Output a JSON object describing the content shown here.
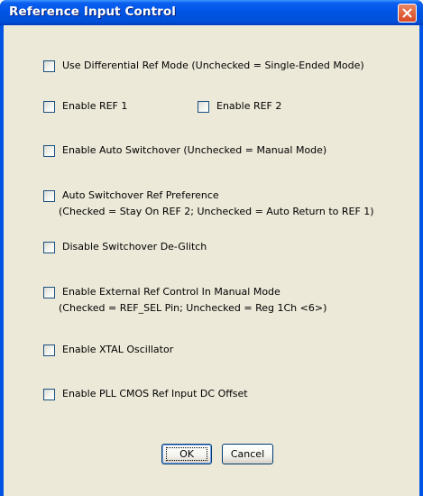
{
  "window": {
    "title": "Reference Input Control",
    "close_icon": "close-icon"
  },
  "options": {
    "diff_ref_mode": {
      "label": "Use Differential Ref Mode (Unchecked = Single-Ended Mode)",
      "checked": false
    },
    "enable_ref1": {
      "label": "Enable REF 1",
      "checked": false
    },
    "enable_ref2": {
      "label": "Enable REF 2",
      "checked": false
    },
    "auto_switchover": {
      "label": "Enable Auto Switchover (Unchecked = Manual Mode)",
      "checked": false
    },
    "switchover_pref": {
      "label": "Auto Switchover Ref Preference",
      "note": "(Checked = Stay On REF 2; Unchecked = Auto Return to REF 1)",
      "checked": false
    },
    "deglitch": {
      "label": "Disable Switchover De-Glitch",
      "checked": false
    },
    "ext_ref_control": {
      "label": "Enable External Ref Control In Manual Mode",
      "note": "(Checked = REF_SEL Pin; Unchecked = Reg 1Ch <6>)",
      "checked": false
    },
    "xtal_osc": {
      "label": "Enable XTAL Oscillator",
      "checked": false
    },
    "pll_cmos_offset": {
      "label": "Enable PLL CMOS Ref Input DC Offset",
      "checked": false
    }
  },
  "buttons": {
    "ok": "OK",
    "cancel": "Cancel"
  },
  "colors": {
    "titlebar": "#0054e3",
    "dialog_bg": "#ece9d8",
    "close_button": "#e26a44"
  }
}
